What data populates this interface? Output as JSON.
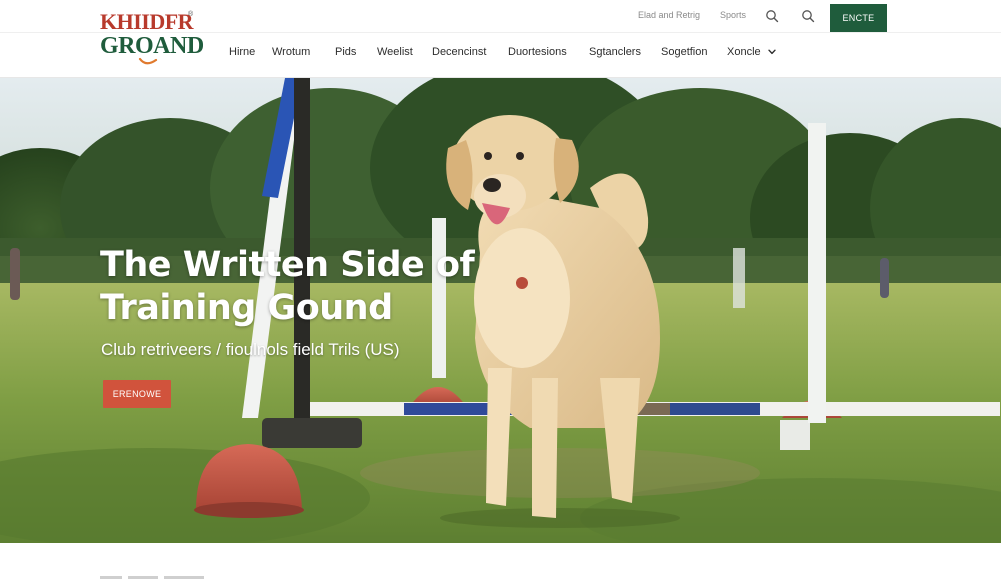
{
  "brand": {
    "logo_line1": "KHIIDFR",
    "logo_line2": "GROAND",
    "logo_mark": "®",
    "colors": {
      "green": "#1f5c3c",
      "orange": "#e07a2e",
      "red": "#b83a2c"
    }
  },
  "utility": {
    "link1": "Elad and Retrig",
    "link2": "Sports",
    "cta_label": "ENCTE"
  },
  "nav": {
    "items": [
      {
        "label": "Hirne"
      },
      {
        "label": "Wrotum"
      },
      {
        "label": "Pids"
      },
      {
        "label": "Weelist"
      },
      {
        "label": "Decencinst"
      },
      {
        "label": "Duortesions"
      },
      {
        "label": "Sgtanclers"
      },
      {
        "label": "Sogetfion"
      },
      {
        "label": "Xoncle"
      }
    ]
  },
  "hero": {
    "title_line1": "The Written Side of",
    "title_line2": "Training Gound",
    "subtitle": "Club retriveers / fioulnols field Trils (US)",
    "button_label": "ERENOWE"
  },
  "icons": {
    "search": "search-icon",
    "search_alt": "magnifier-icon",
    "chevron": "chevron-down-icon"
  }
}
